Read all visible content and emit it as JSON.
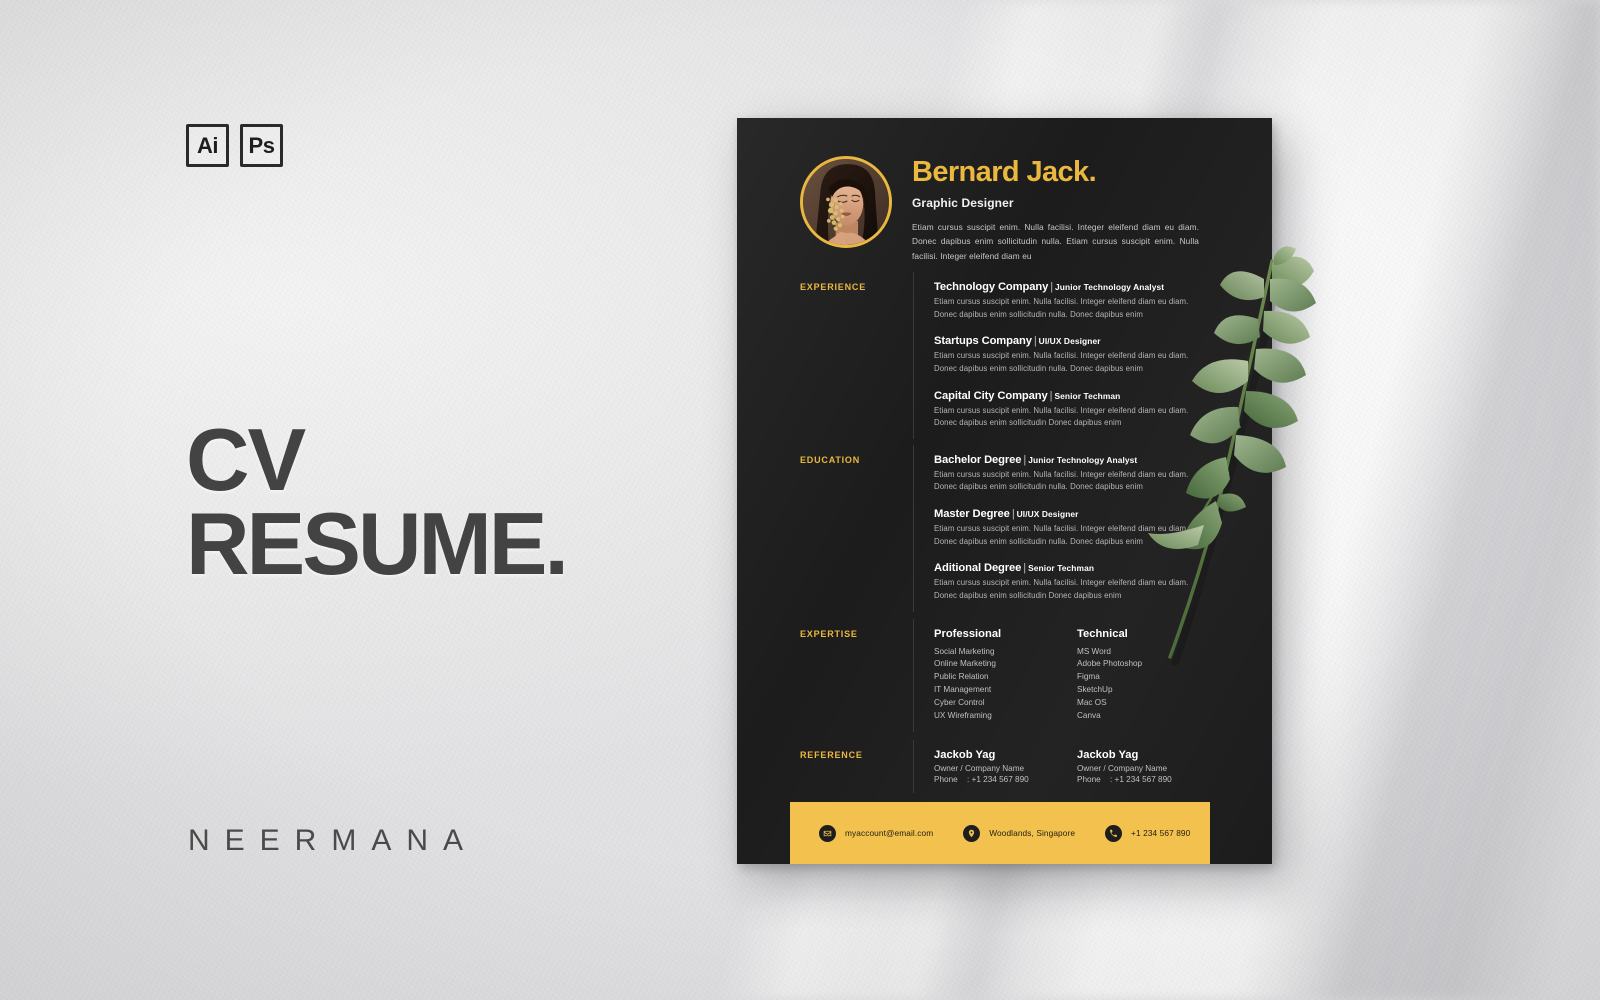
{
  "background": {
    "wall_color": "#e9e9ea",
    "accent": "#eab83f",
    "dark": "#1c1c1c",
    "footer_yellow": "#f2c14e"
  },
  "left_panel": {
    "badges": [
      {
        "label": "Ai",
        "name": "adobe-illustrator-badge"
      },
      {
        "label": "Ps",
        "name": "adobe-photoshop-badge"
      }
    ],
    "title_line1": "CV",
    "title_line2": "RESUME.",
    "brand": "NEERMANA"
  },
  "resume": {
    "name": "Bernard Jack.",
    "role": "Graphic Designer",
    "intro": "Etiam cursus suscipit enim. Nulla facilisi. Integer eleifend diam eu diam. Donec dapibus enim sollicitudin nulla. Etiam cursus suscipit enim. Nulla facilisi. Integer eleifend diam eu",
    "sections": [
      {
        "label": "EXPERIENCE",
        "entries": [
          {
            "title": "Technology Company",
            "subtitle": "Junior Technology Analyst",
            "desc": "Etiam cursus suscipit enim. Nulla facilisi. Integer eleifend diam eu diam. Donec dapibus enim sollicitudin nulla. Donec dapibus enim"
          },
          {
            "title": "Startups Company",
            "subtitle": "UI/UX Designer",
            "desc": "Etiam cursus suscipit enim. Nulla facilisi. Integer eleifend diam eu diam. Donec dapibus enim sollicitudin nulla. Donec dapibus enim"
          },
          {
            "title": "Capital City Company",
            "subtitle": "Senior Techman",
            "desc": "Etiam cursus suscipit enim. Nulla facilisi. Integer eleifend diam eu diam. Donec dapibus enim sollicitudin Donec dapibus enim"
          }
        ]
      },
      {
        "label": "EDUCATION",
        "entries": [
          {
            "title": "Bachelor Degree",
            "subtitle": "Junior Technology Analyst",
            "desc": "Etiam cursus suscipit enim. Nulla facilisi. Integer eleifend diam eu diam. Donec dapibus enim sollicitudin nulla. Donec dapibus enim"
          },
          {
            "title": "Master Degree",
            "subtitle": "UI/UX Designer",
            "desc": "Etiam cursus suscipit enim. Nulla facilisi. Integer eleifend diam eu diam. Donec dapibus enim sollicitudin nulla. Donec dapibus enim"
          },
          {
            "title": "Aditional Degree",
            "subtitle": "Senior Techman",
            "desc": "Etiam cursus suscipit enim. Nulla facilisi. Integer eleifend diam eu diam. Donec dapibus enim sollicitudin Donec dapibus enim"
          }
        ]
      }
    ],
    "expertise": {
      "label": "EXPERTISE",
      "columns": [
        {
          "heading": "Professional",
          "items": [
            "Social Marketing",
            "Online Marketing",
            "Public Relation",
            "IT Management",
            "Cyber Control",
            "UX Wireframing"
          ]
        },
        {
          "heading": "Technical",
          "items": [
            "MS Word",
            "Adobe Photoshop",
            "Figma",
            "SketchUp",
            "Mac OS",
            "Canva"
          ]
        }
      ]
    },
    "reference": {
      "label": "REFERENCE",
      "people": [
        {
          "name": "Jackob Yag",
          "role": "Owner / Company Name",
          "phone_key": "Phone",
          "phone_value": ": +1 234 567 890"
        },
        {
          "name": "Jackob Yag",
          "role": "Owner / Company Name",
          "phone_key": "Phone",
          "phone_value": ": +1 234 567 890"
        }
      ]
    },
    "footer": {
      "items": [
        {
          "icon": "envelope-icon",
          "text": "myaccount@email.com"
        },
        {
          "icon": "location-pin-icon",
          "text": "Woodlands, Singapore"
        },
        {
          "icon": "phone-icon",
          "text": "+1 234 567 890"
        }
      ]
    }
  }
}
